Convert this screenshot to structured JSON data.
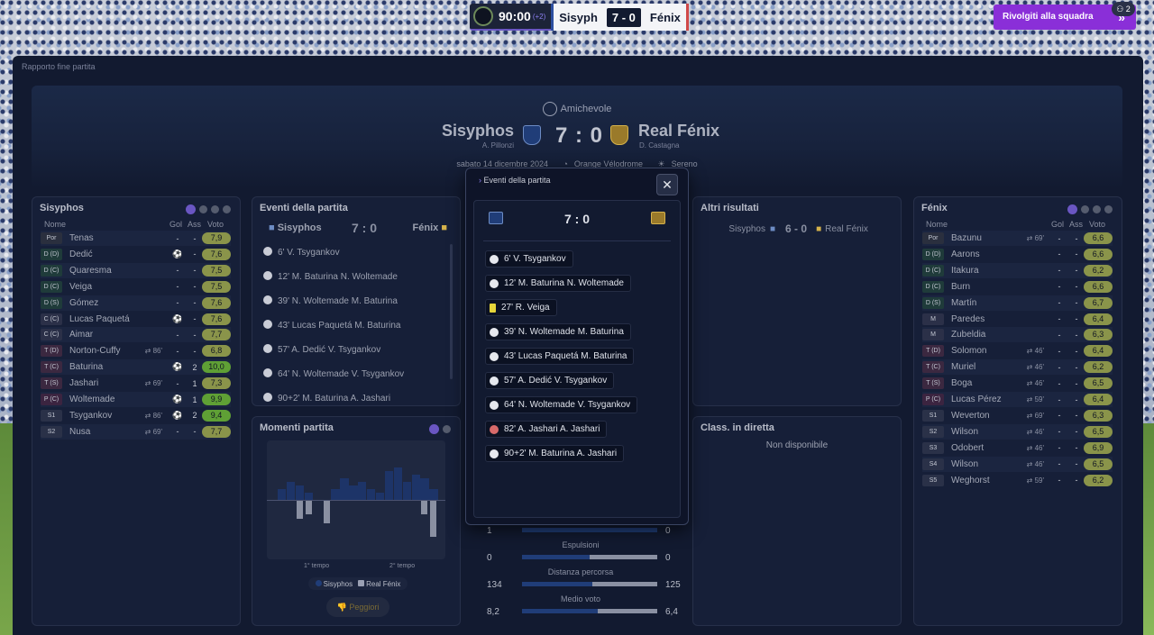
{
  "topbar": {
    "time": "90:00",
    "added": "(+2)",
    "home_short": "Sisyph",
    "score": "7 - 0",
    "away_short": "Fénix"
  },
  "back_button": "Rivolgiti alla squadra",
  "notifications": "2",
  "breadcrumb": "Rapporto fine partita",
  "header": {
    "competition": "Amichevole",
    "home": "Sisyphos",
    "home_coach": "A. Pillonzi",
    "away": "Real Fénix",
    "away_coach": "D. Castagna",
    "score": "7 : 0",
    "date": "sabato 14 dicembre 2024",
    "venue": "Orange Vélodrome",
    "weather": "Sereno"
  },
  "home_panel": {
    "title": "Sisyphos",
    "cols": {
      "name": "Nome",
      "gol": "Gol",
      "ass": "Ass",
      "vote": "Voto"
    },
    "players": [
      {
        "pos": "Por",
        "name": "Tenas",
        "sub": "",
        "gol": "-",
        "ass": "-",
        "vote": "7,9"
      },
      {
        "pos": "D (D)",
        "name": "Dedić",
        "sub": "",
        "gol": "⚽",
        "ass": "-",
        "vote": "7,6"
      },
      {
        "pos": "D (C)",
        "name": "Quaresma",
        "sub": "",
        "gol": "-",
        "ass": "-",
        "vote": "7,5"
      },
      {
        "pos": "D (C)",
        "name": "Veiga",
        "sub": "",
        "gol": "-",
        "ass": "-",
        "vote": "7,5"
      },
      {
        "pos": "D (S)",
        "name": "Gómez",
        "sub": "",
        "gol": "-",
        "ass": "-",
        "vote": "7,6"
      },
      {
        "pos": "C (C)",
        "name": "Lucas Paquetá",
        "sub": "",
        "gol": "⚽",
        "ass": "-",
        "vote": "7,6"
      },
      {
        "pos": "C (C)",
        "name": "Aimar",
        "sub": "",
        "gol": "-",
        "ass": "-",
        "vote": "7,7"
      },
      {
        "pos": "T (D)",
        "name": "Norton-Cuffy",
        "sub": "86'",
        "gol": "-",
        "ass": "-",
        "vote": "6,8"
      },
      {
        "pos": "T (C)",
        "name": "Baturina",
        "sub": "",
        "gol": "⚽",
        "ass": "2",
        "vote": "10,0"
      },
      {
        "pos": "T (S)",
        "name": "Jashari",
        "sub": "69'",
        "gol": "-",
        "ass": "1",
        "vote": "7,3"
      },
      {
        "pos": "P (C)",
        "name": "Woltemade",
        "sub": "",
        "gol": "⚽",
        "ass": "1",
        "vote": "9,9"
      },
      {
        "pos": "S1",
        "name": "Tsygankov",
        "sub": "86'",
        "gol": "⚽",
        "ass": "2",
        "vote": "9,4"
      },
      {
        "pos": "S2",
        "name": "Nusa",
        "sub": "69'",
        "gol": "-",
        "ass": "-",
        "vote": "7,7"
      }
    ]
  },
  "away_panel": {
    "title": "Fénix",
    "cols": {
      "name": "Nome",
      "gol": "Gol",
      "ass": "Ass",
      "vote": "Voto"
    },
    "players": [
      {
        "pos": "Por",
        "name": "Bazunu",
        "sub": "69'",
        "gol": "-",
        "ass": "-",
        "vote": "6,6"
      },
      {
        "pos": "D (D)",
        "name": "Aarons",
        "sub": "",
        "gol": "-",
        "ass": "-",
        "vote": "6,6"
      },
      {
        "pos": "D (C)",
        "name": "Itakura",
        "sub": "",
        "gol": "-",
        "ass": "-",
        "vote": "6,2"
      },
      {
        "pos": "D (C)",
        "name": "Burn",
        "sub": "",
        "gol": "-",
        "ass": "-",
        "vote": "6,6"
      },
      {
        "pos": "D (S)",
        "name": "Martín",
        "sub": "",
        "gol": "-",
        "ass": "-",
        "vote": "6,7"
      },
      {
        "pos": "M",
        "name": "Paredes",
        "sub": "",
        "gol": "-",
        "ass": "-",
        "vote": "6,4"
      },
      {
        "pos": "M",
        "name": "Zubeldia",
        "sub": "",
        "gol": "-",
        "ass": "-",
        "vote": "6,3"
      },
      {
        "pos": "T (D)",
        "name": "Solomon",
        "sub": "46'",
        "gol": "-",
        "ass": "-",
        "vote": "6,4"
      },
      {
        "pos": "T (C)",
        "name": "Muriel",
        "sub": "46'",
        "gol": "-",
        "ass": "-",
        "vote": "6,2"
      },
      {
        "pos": "T (S)",
        "name": "Boga",
        "sub": "46'",
        "gol": "-",
        "ass": "-",
        "vote": "6,5"
      },
      {
        "pos": "P (C)",
        "name": "Lucas Pérez",
        "sub": "59'",
        "gol": "-",
        "ass": "-",
        "vote": "6,4"
      },
      {
        "pos": "S1",
        "name": "Weverton",
        "sub": "69'",
        "gol": "-",
        "ass": "-",
        "vote": "6,3"
      },
      {
        "pos": "S2",
        "name": "Wilson",
        "sub": "46'",
        "gol": "-",
        "ass": "-",
        "vote": "6,5"
      },
      {
        "pos": "S3",
        "name": "Odobert",
        "sub": "46'",
        "gol": "-",
        "ass": "-",
        "vote": "6,9"
      },
      {
        "pos": "S4",
        "name": "Wilson",
        "sub": "46'",
        "gol": "-",
        "ass": "-",
        "vote": "6,5"
      },
      {
        "pos": "S5",
        "name": "Weghorst",
        "sub": "59'",
        "gol": "-",
        "ass": "-",
        "vote": "6,2"
      }
    ]
  },
  "events_panel": {
    "title": "Eventi della partita",
    "home": "Sisyphos",
    "score": "7 : 0",
    "away": "Fénix",
    "events": [
      "6' V. Tsygankov",
      "12' M. Baturina N. Woltemade",
      "39' N. Woltemade M. Baturina",
      "43' Lucas Paquetá M. Baturina",
      "57' A. Dedić V. Tsygankov",
      "64' N. Woltemade V. Tsygankov",
      "90+2' M. Baturina A. Jashari"
    ]
  },
  "moments_panel": {
    "title": "Momenti partita",
    "half1": "1° tempo",
    "half2": "2° tempo",
    "legend_home": "Sisyphos",
    "legend_away": "Real Fénix",
    "worse_button": "Peggiori",
    "home_bars": [
      3,
      5,
      4,
      2,
      0,
      0,
      3,
      6,
      4,
      5,
      3,
      2,
      8,
      9,
      5,
      7,
      6,
      3
    ],
    "away_bars": [
      0,
      0,
      4,
      3,
      0,
      5,
      0,
      0,
      0,
      0,
      0,
      0,
      0,
      0,
      0,
      0,
      3,
      8
    ]
  },
  "other_results": {
    "title": "Altri risultati",
    "home": "Sisyphos",
    "score": "6 - 0",
    "away": "Real Fénix"
  },
  "live_table": {
    "title": "Class. in diretta",
    "message": "Non disponibile"
  },
  "stats": [
    {
      "label": "",
      "home": "1",
      "away": "0",
      "home_share": 1.0
    },
    {
      "label": "Espulsioni",
      "home": "0",
      "away": "0",
      "home_share": 0.5
    },
    {
      "label": "Distanza percorsa",
      "home": "134",
      "away": "125",
      "home_share": 0.52
    },
    {
      "label": "Medio voto",
      "home": "8,2",
      "away": "6,4",
      "home_share": 0.56
    }
  ],
  "modal": {
    "title": "Eventi della partita",
    "score": "7 : 0",
    "events": [
      {
        "type": "goal",
        "text": "6' V. Tsygankov"
      },
      {
        "type": "goal",
        "text": "12' M. Baturina N. Woltemade"
      },
      {
        "type": "yellow",
        "text": "27' R. Veiga"
      },
      {
        "type": "goal",
        "text": "39' N. Woltemade M. Baturina"
      },
      {
        "type": "goal",
        "text": "43' Lucas Paquetá M. Baturina"
      },
      {
        "type": "goal",
        "text": "57' A. Dedić V. Tsygankov"
      },
      {
        "type": "goal",
        "text": "64' N. Woltemade V. Tsygankov"
      },
      {
        "type": "own",
        "text": "82' A. Jashari A. Jashari"
      },
      {
        "type": "goal",
        "text": "90+2' M. Baturina A. Jashari"
      }
    ]
  }
}
